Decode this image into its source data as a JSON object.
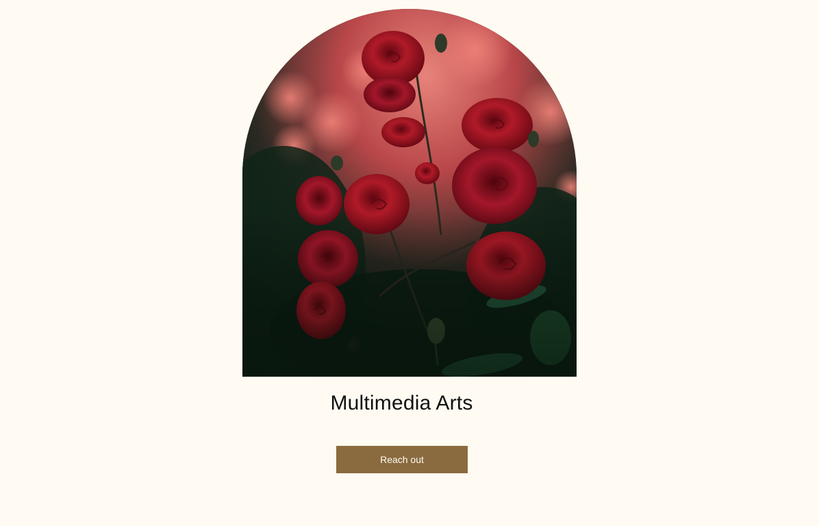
{
  "hero": {
    "image_subject": "red roses bush",
    "colors": {
      "background_glow": "#e5736c",
      "rose_dark": "#8d0f1c",
      "rose_mid": "#b51c2a",
      "foliage": "#12291d"
    }
  },
  "title": "Multimedia Arts",
  "cta": {
    "label": "Reach out",
    "color": "#8a6a3f"
  },
  "page": {
    "background": "#fffbf2"
  }
}
